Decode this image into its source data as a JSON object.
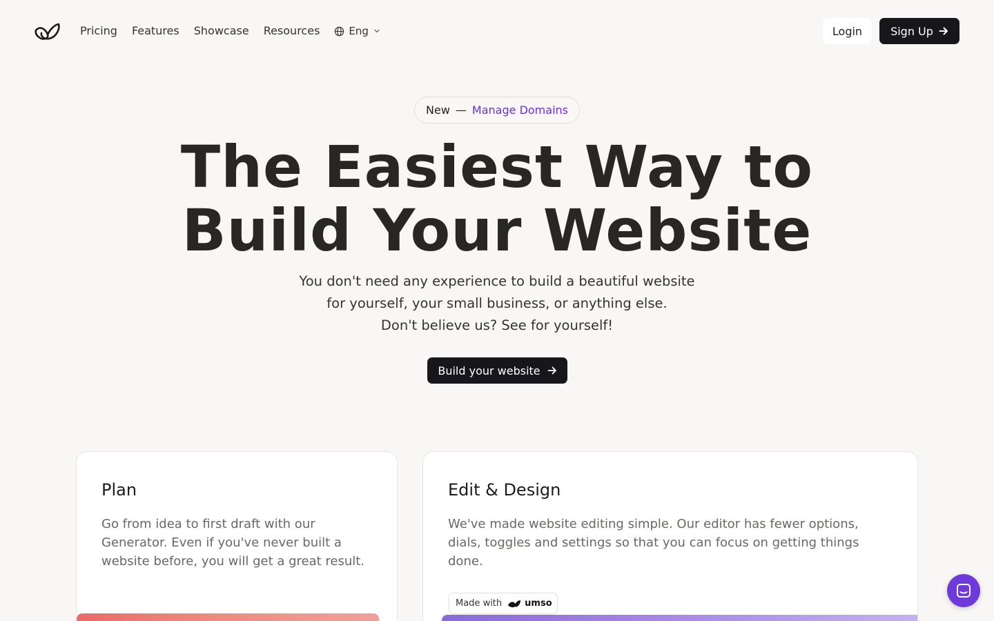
{
  "nav": {
    "logo_name": "umso-logo",
    "links": [
      "Pricing",
      "Features",
      "Showcase",
      "Resources"
    ],
    "language": "Eng",
    "login_label": "Login",
    "signup_label": "Sign Up"
  },
  "hero": {
    "badge_new": "New",
    "badge_dash": "—",
    "badge_link": "Manage Domains",
    "title_line1": "The Easiest Way to",
    "title_line2": "Build Your Website",
    "subtitle_line1": "You don't need any experience to build a beautiful website",
    "subtitle_line2": "for yourself, your small business, or anything else.",
    "subtitle_line3": "Don't believe us? See for yourself!",
    "cta_label": "Build your website"
  },
  "cards": {
    "plan": {
      "title": "Plan",
      "body": "Go from idea to first draft with our Generator. Even if you've never built a website before, you will get a great result."
    },
    "edit": {
      "title": "Edit & Design",
      "body": "We've made website editing simple. Our editor has fewer options, dials, toggles and settings so that you can focus on getting things done."
    }
  },
  "made_with": {
    "label": "Made with",
    "brand": "umso"
  },
  "colors": {
    "background": "#f9f7f5",
    "primary_dark": "#17161a",
    "accent_purple": "#6d2ed8",
    "chat_purple": "#6f3ad9"
  },
  "icons": {
    "globe": "globe-icon",
    "chevron": "chevron-down-icon",
    "arrow": "arrow-right-icon",
    "chat": "chat-icon"
  }
}
